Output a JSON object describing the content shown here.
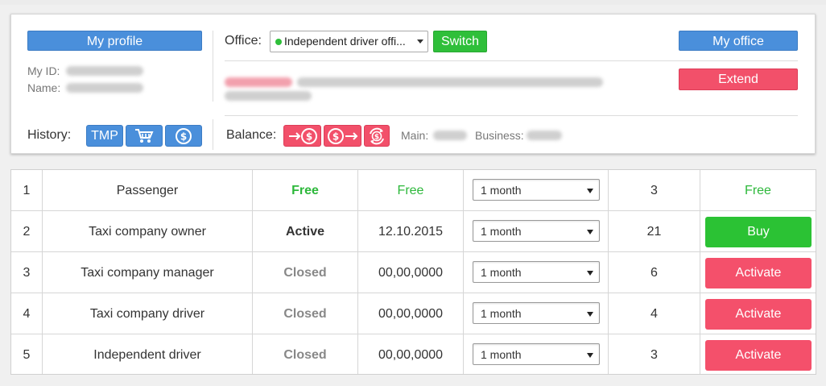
{
  "header": {
    "my_profile_label": "My profile",
    "my_id_label": "My ID:",
    "name_label": "Name:",
    "office_label": "Office:",
    "office_selected": "Independent driver offi...",
    "switch_label": "Switch",
    "my_office_label": "My office",
    "extend_label": "Extend",
    "history_label": "History:",
    "history_tmp_label": "TMP",
    "balance_label": "Balance:",
    "main_label": "Main:",
    "business_label": "Business:",
    "colors": {
      "blue": "#4a8fdb",
      "green": "#2fbf3a",
      "red": "#f2506a"
    },
    "icons": [
      "cart-icon",
      "dollar-coin-icon",
      "transfer-out-icon",
      "transfer-in-icon",
      "refresh-coin-icon"
    ]
  },
  "table": {
    "rows": [
      {
        "num": "1",
        "name": "Passenger",
        "status": "Free",
        "date": "Free",
        "period": "1 month",
        "count": "3",
        "action": "Free"
      },
      {
        "num": "2",
        "name": "Taxi company owner",
        "status": "Active",
        "date": "12.10.2015",
        "period": "1 month",
        "count": "21",
        "action": "Buy"
      },
      {
        "num": "3",
        "name": "Taxi company manager",
        "status": "Closed",
        "date": "00,00,0000",
        "period": "1 month",
        "count": "6",
        "action": "Activate"
      },
      {
        "num": "4",
        "name": "Taxi company driver",
        "status": "Closed",
        "date": "00,00,0000",
        "period": "1 month",
        "count": "4",
        "action": "Activate"
      },
      {
        "num": "5",
        "name": "Independent driver",
        "status": "Closed",
        "date": "00,00,0000",
        "period": "1 month",
        "count": "3",
        "action": "Activate"
      }
    ]
  }
}
